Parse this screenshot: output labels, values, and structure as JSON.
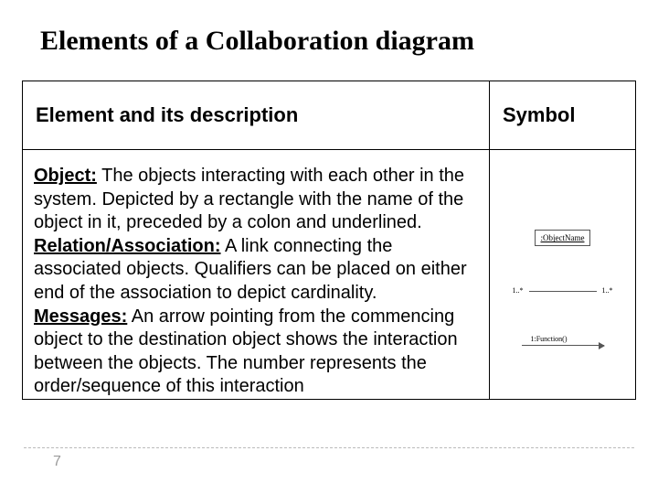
{
  "title": "Elements of a Collaboration diagram",
  "headers": {
    "left": "Element and its description",
    "right": "Symbol"
  },
  "rows": [
    {
      "term": "Object:",
      "desc": " The objects interacting with each other in the system. Depicted by a rectangle with the name of the object in it, preceded by a colon and underlined."
    },
    {
      "term": "Relation/Association:",
      "desc": " A link connecting the associated objects. Qualifiers can be placed on either end of the association to depict cardinality."
    },
    {
      "term": "Messages:",
      "desc": " An arrow pointing from the commencing object to the destination object shows the interaction between the objects. The number represents the order/sequence of this interaction"
    }
  ],
  "symbols": {
    "object_label": ":ObjectName",
    "assoc_left": "1..*",
    "assoc_right": "1..*",
    "message_label": "1:Function()"
  },
  "page_number": "7"
}
